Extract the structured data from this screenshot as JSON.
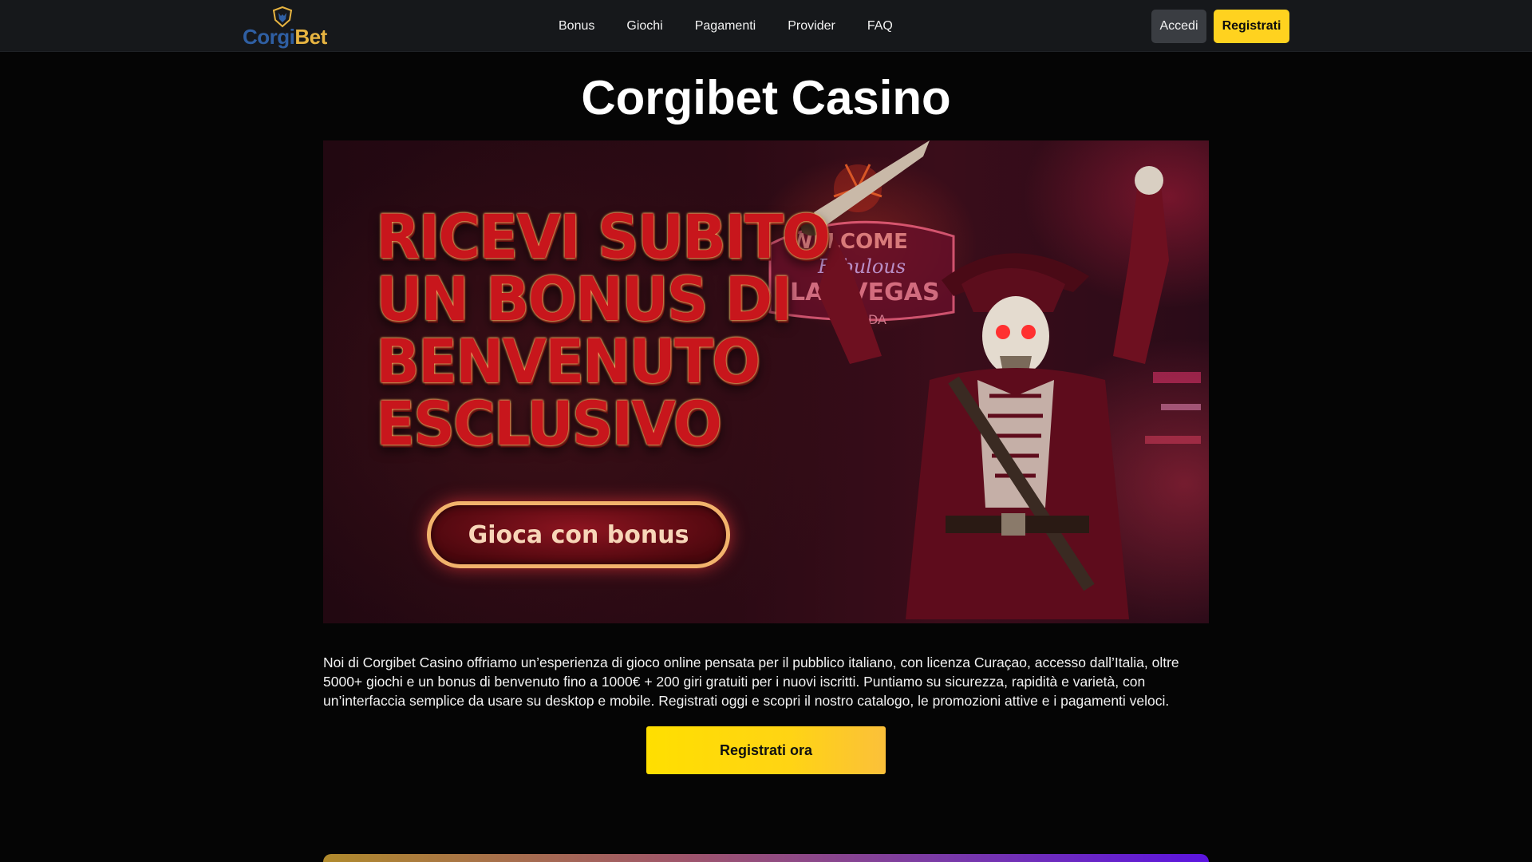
{
  "header": {
    "logo": {
      "part1": "Corgi",
      "part2": "Bet"
    },
    "nav": [
      {
        "label": "Bonus"
      },
      {
        "label": "Giochi"
      },
      {
        "label": "Pagamenti"
      },
      {
        "label": "Provider"
      },
      {
        "label": "FAQ"
      }
    ],
    "login_label": "Accedi",
    "register_label": "Registrati"
  },
  "page_title": "Corgibet Casino",
  "banner": {
    "headline": [
      "RICEVI SUBITO",
      "UN BONUS DI",
      "BENVENUTO",
      "ESCLUSIVO"
    ],
    "cta_label": "Gioca con bonus",
    "sign_text": [
      "WELCOME",
      "Fabulous",
      "LAS VEGAS",
      "NEVADA"
    ]
  },
  "intro_text": "Noi di Corgibet Casino offriamo un’esperienza di gioco online pensata per il pubblico italiano, con licenza Curaçao, accesso dall’Italia, oltre 5000+ giochi e un bonus di benvenuto fino a 1000€ + 200 giri gratuiti per i nuovi iscritti. Puntiamo su sicurezza, rapidità e varietà, con un’interfaccia semplice da usare su desktop e mobile. Registrati oggi e scopri il nostro catalogo, le promozioni attive e i pagamenti veloci.",
  "cta_label": "Registrati ora",
  "colors": {
    "accent": "#ffd21f",
    "header_bg": "#16181b",
    "page_bg": "#050505"
  }
}
